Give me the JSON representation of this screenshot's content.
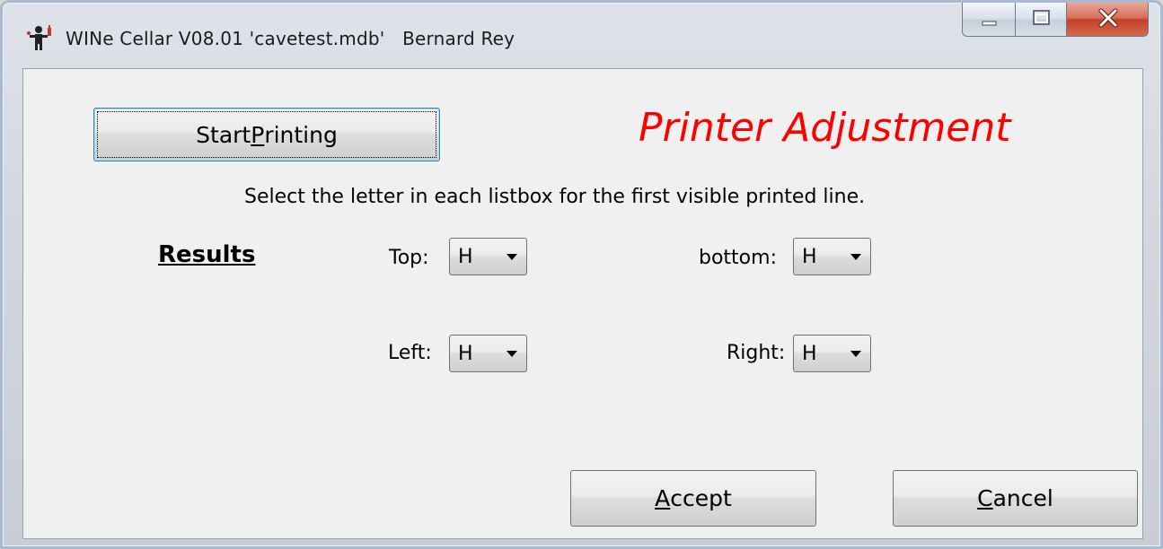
{
  "window": {
    "title": "WINe Cellar V08.01 'cavetest.mdb'   Bernard Rey",
    "controls": {
      "minimize_icon": "minimize-icon",
      "maximize_icon": "maximize-icon",
      "close_icon": "close-icon"
    }
  },
  "dialog": {
    "start_button": {
      "pre": "Start ",
      "accel": "P",
      "post": "rinting"
    },
    "heading": "Printer Adjustment",
    "heading_color": "#ff0000",
    "instruction": "Select the letter in each listbox for the first visible printed line.",
    "results_label": "Results",
    "fields": {
      "top": {
        "label": "Top:",
        "value": "H"
      },
      "bottom": {
        "label": "bottom:",
        "value": "H"
      },
      "left": {
        "label": "Left:",
        "value": "H"
      },
      "right": {
        "label": "Right:",
        "value": "H"
      }
    },
    "accept_button": {
      "accel": "A",
      "rest": "ccept"
    },
    "cancel_button": {
      "accel": "C",
      "rest": "ancel"
    }
  }
}
